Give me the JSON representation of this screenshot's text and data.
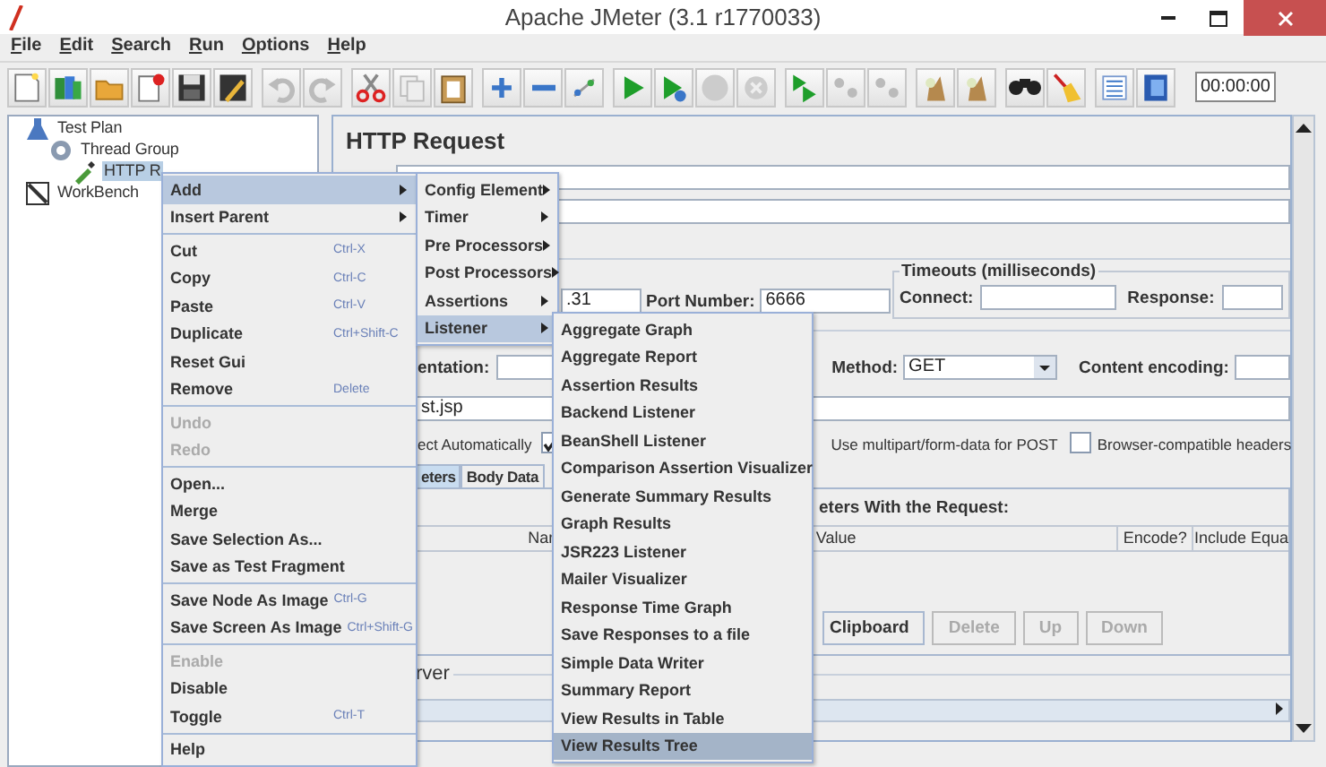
{
  "window": {
    "title": "Apache JMeter (3.1 r1770033)"
  },
  "menu_bar": [
    "File",
    "Edit",
    "Search",
    "Run",
    "Options",
    "Help"
  ],
  "toolbar": {
    "timer": "00:00:00"
  },
  "tree": [
    {
      "label": "Test Plan",
      "kind": "plan",
      "selected": false,
      "children": [
        {
          "label": "Thread Group",
          "kind": "group",
          "selected": false,
          "children": [
            {
              "label": "HTTP R",
              "kind": "sampler",
              "selected": true
            }
          ]
        }
      ]
    },
    {
      "label": "WorkBench",
      "kind": "workbench",
      "selected": false
    }
  ],
  "panel": {
    "title": "HTTP Request",
    "server_value": ".31",
    "port_label": "Port Number:",
    "port_value": "6666",
    "timeouts": {
      "title": "Timeouts (milliseconds)",
      "connect_label": "Connect:",
      "response_label": "Response:"
    },
    "implementation_label": "entation:",
    "method_label": "Method:",
    "method_value": "GET",
    "content_encoding_label": "Content encoding:",
    "path_value": "st.jsp",
    "redirect_label": "ect Automatically",
    "follow_checked": true,
    "multipart_label": "Use multipart/form-data for POST",
    "browser_headers_checked": false,
    "browser_headers_label": "Browser-compatible headers",
    "tabs": [
      {
        "label": "eters",
        "selected": true
      },
      {
        "label": "Body Data",
        "selected": false
      }
    ],
    "params_title": "eters With the Request:",
    "table_columns": [
      "Nar",
      "Value",
      "Encode?",
      "Include Equa"
    ],
    "buttons": [
      {
        "label": "Clipboard",
        "disabled": false
      },
      {
        "label": "Delete",
        "disabled": true
      },
      {
        "label": "Up",
        "disabled": true
      },
      {
        "label": "Down",
        "disabled": true
      }
    ],
    "proxy_title": "rver"
  },
  "context_menu": {
    "items": [
      {
        "kind": "item",
        "label": "Add",
        "submenu": true,
        "disabled": false,
        "selected": true
      },
      {
        "kind": "item",
        "label": "Insert Parent",
        "submenu": true,
        "disabled": false,
        "selected": false
      },
      {
        "kind": "separator"
      },
      {
        "kind": "item",
        "label": "Cut",
        "shortcut": "Ctrl-X",
        "submenu": false,
        "disabled": false,
        "selected": false
      },
      {
        "kind": "item",
        "label": "Copy",
        "shortcut": "Ctrl-C",
        "submenu": false,
        "disabled": false,
        "selected": false
      },
      {
        "kind": "item",
        "label": "Paste",
        "shortcut": "Ctrl-V",
        "submenu": false,
        "disabled": false,
        "selected": false
      },
      {
        "kind": "item",
        "label": "Duplicate",
        "shortcut": "Ctrl+Shift-C",
        "submenu": false,
        "disabled": false,
        "selected": false
      },
      {
        "kind": "item",
        "label": "Reset Gui",
        "submenu": false,
        "disabled": false,
        "selected": false
      },
      {
        "kind": "item",
        "label": "Remove",
        "shortcut": "Delete",
        "submenu": false,
        "disabled": false,
        "selected": false
      },
      {
        "kind": "separator"
      },
      {
        "kind": "item",
        "label": "Undo",
        "submenu": false,
        "disabled": true,
        "selected": false
      },
      {
        "kind": "item",
        "label": "Redo",
        "submenu": false,
        "disabled": true,
        "selected": false
      },
      {
        "kind": "separator"
      },
      {
        "kind": "item",
        "label": "Open...",
        "submenu": false,
        "disabled": false,
        "selected": false
      },
      {
        "kind": "item",
        "label": "Merge",
        "submenu": false,
        "disabled": false,
        "selected": false
      },
      {
        "kind": "item",
        "label": "Save Selection As...",
        "submenu": false,
        "disabled": false,
        "selected": false
      },
      {
        "kind": "item",
        "label": "Save as Test Fragment",
        "submenu": false,
        "disabled": false,
        "selected": false
      },
      {
        "kind": "separator"
      },
      {
        "kind": "item",
        "label": "Save Node As Image",
        "shortcut": "Ctrl-G",
        "submenu": false,
        "disabled": false,
        "selected": false
      },
      {
        "kind": "item",
        "label": "Save Screen As Image",
        "shortcut": "Ctrl+Shift-G",
        "submenu": false,
        "disabled": false,
        "selected": false
      },
      {
        "kind": "separator"
      },
      {
        "kind": "item",
        "label": "Enable",
        "submenu": false,
        "disabled": true,
        "selected": false
      },
      {
        "kind": "item",
        "label": "Disable",
        "submenu": false,
        "disabled": false,
        "selected": false
      },
      {
        "kind": "item",
        "label": "Toggle",
        "shortcut": "Ctrl-T",
        "submenu": false,
        "disabled": false,
        "selected": false
      },
      {
        "kind": "separator"
      },
      {
        "kind": "item",
        "label": "Help",
        "submenu": false,
        "disabled": false,
        "selected": false
      }
    ]
  },
  "add_submenu": {
    "items": [
      {
        "label": "Config Element",
        "selected": false
      },
      {
        "label": "Timer",
        "selected": false
      },
      {
        "label": "Pre Processors",
        "selected": false
      },
      {
        "label": "Post Processors",
        "selected": false
      },
      {
        "label": "Assertions",
        "selected": false
      },
      {
        "label": "Listener",
        "selected": true
      }
    ]
  },
  "listener_submenu": {
    "items": [
      {
        "label": "Aggregate Graph",
        "selected": false
      },
      {
        "label": "Aggregate Report",
        "selected": false
      },
      {
        "label": "Assertion Results",
        "selected": false
      },
      {
        "label": "Backend Listener",
        "selected": false
      },
      {
        "label": "BeanShell Listener",
        "selected": false
      },
      {
        "label": "Comparison Assertion Visualizer",
        "selected": false
      },
      {
        "label": "Generate Summary Results",
        "selected": false
      },
      {
        "label": "Graph Results",
        "selected": false
      },
      {
        "label": "JSR223 Listener",
        "selected": false
      },
      {
        "label": "Mailer Visualizer",
        "selected": false
      },
      {
        "label": "Response Time Graph",
        "selected": false
      },
      {
        "label": "Save Responses to a file",
        "selected": false
      },
      {
        "label": "Simple Data Writer",
        "selected": false
      },
      {
        "label": "Summary Report",
        "selected": false
      },
      {
        "label": "View Results in Table",
        "selected": false
      },
      {
        "label": "View Results Tree",
        "selected": true
      }
    ]
  }
}
